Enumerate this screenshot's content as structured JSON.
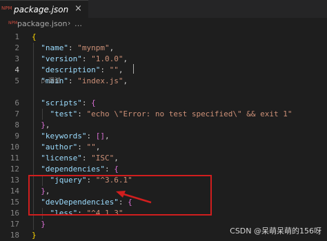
{
  "tab": {
    "icon_text": "NPM",
    "title": "package.json",
    "close_glyph": "×"
  },
  "breadcrumb": {
    "icon_text": "NPM",
    "file": "package.json",
    "separator": "›",
    "more": "…"
  },
  "code_lens": "▷ 调试",
  "line_numbers": [
    "1",
    "2",
    "3",
    "4",
    "5",
    "6",
    "7",
    "8",
    "9",
    "10",
    "11",
    "12",
    "13",
    "14",
    "15",
    "16",
    "17",
    "18"
  ],
  "lines": [
    [
      {
        "t": "{",
        "c": "b1"
      }
    ],
    [
      {
        "t": "  ",
        "c": "p"
      },
      {
        "t": "\"name\"",
        "c": "k"
      },
      {
        "t": ": ",
        "c": "p"
      },
      {
        "t": "\"mynpm\"",
        "c": "s"
      },
      {
        "t": ",",
        "c": "p"
      }
    ],
    [
      {
        "t": "  ",
        "c": "p"
      },
      {
        "t": "\"version\"",
        "c": "k"
      },
      {
        "t": ": ",
        "c": "p"
      },
      {
        "t": "\"1.0.0\"",
        "c": "s"
      },
      {
        "t": ",",
        "c": "p"
      }
    ],
    [
      {
        "t": "  ",
        "c": "p"
      },
      {
        "t": "\"description\"",
        "c": "k"
      },
      {
        "t": ": ",
        "c": "p"
      },
      {
        "t": "\"\"",
        "c": "s"
      },
      {
        "t": ",",
        "c": "p"
      }
    ],
    [
      {
        "t": "  ",
        "c": "p"
      },
      {
        "t": "\"main\"",
        "c": "k"
      },
      {
        "t": ": ",
        "c": "p"
      },
      {
        "t": "\"index.js\"",
        "c": "s"
      },
      {
        "t": ",",
        "c": "p"
      }
    ],
    [
      {
        "t": "  ",
        "c": "p"
      },
      {
        "t": "\"scripts\"",
        "c": "k"
      },
      {
        "t": ": ",
        "c": "p"
      },
      {
        "t": "{",
        "c": "b2"
      }
    ],
    [
      {
        "t": "    ",
        "c": "p"
      },
      {
        "t": "\"test\"",
        "c": "k"
      },
      {
        "t": ": ",
        "c": "p"
      },
      {
        "t": "\"echo \\\"Error: no test specified\\\" && exit 1\"",
        "c": "s"
      }
    ],
    [
      {
        "t": "  ",
        "c": "p"
      },
      {
        "t": "}",
        "c": "b2"
      },
      {
        "t": ",",
        "c": "p"
      }
    ],
    [
      {
        "t": "  ",
        "c": "p"
      },
      {
        "t": "\"keywords\"",
        "c": "k"
      },
      {
        "t": ": ",
        "c": "p"
      },
      {
        "t": "[]",
        "c": "b2"
      },
      {
        "t": ",",
        "c": "p"
      }
    ],
    [
      {
        "t": "  ",
        "c": "p"
      },
      {
        "t": "\"author\"",
        "c": "k"
      },
      {
        "t": ": ",
        "c": "p"
      },
      {
        "t": "\"\"",
        "c": "s"
      },
      {
        "t": ",",
        "c": "p"
      }
    ],
    [
      {
        "t": "  ",
        "c": "p"
      },
      {
        "t": "\"license\"",
        "c": "k"
      },
      {
        "t": ": ",
        "c": "p"
      },
      {
        "t": "\"ISC\"",
        "c": "s"
      },
      {
        "t": ",",
        "c": "p"
      }
    ],
    [
      {
        "t": "  ",
        "c": "p"
      },
      {
        "t": "\"dependencies\"",
        "c": "k"
      },
      {
        "t": ": ",
        "c": "p"
      },
      {
        "t": "{",
        "c": "b2"
      }
    ],
    [
      {
        "t": "    ",
        "c": "p"
      },
      {
        "t": "\"jquery\"",
        "c": "k"
      },
      {
        "t": ": ",
        "c": "p"
      },
      {
        "t": "\"^3.6.1\"",
        "c": "s"
      }
    ],
    [
      {
        "t": "  ",
        "c": "p"
      },
      {
        "t": "}",
        "c": "b2"
      },
      {
        "t": ",",
        "c": "p"
      }
    ],
    [
      {
        "t": "  ",
        "c": "p"
      },
      {
        "t": "\"devDependencies\"",
        "c": "k"
      },
      {
        "t": ": ",
        "c": "p"
      },
      {
        "t": "{",
        "c": "b2"
      }
    ],
    [
      {
        "t": "    ",
        "c": "p"
      },
      {
        "t": "\"less\"",
        "c": "k"
      },
      {
        "t": ": ",
        "c": "p"
      },
      {
        "t": "\"^4.1.3\"",
        "c": "s"
      }
    ],
    [
      {
        "t": "  ",
        "c": "p"
      },
      {
        "t": "}",
        "c": "b2"
      }
    ],
    [
      {
        "t": "}",
        "c": "b1"
      }
    ]
  ],
  "active_line": 4,
  "colors": {
    "highlight_box": "#d21e1e",
    "arrow": "#d21e1e"
  },
  "watermark": "CSDN @呆萌呆萌的156呀"
}
